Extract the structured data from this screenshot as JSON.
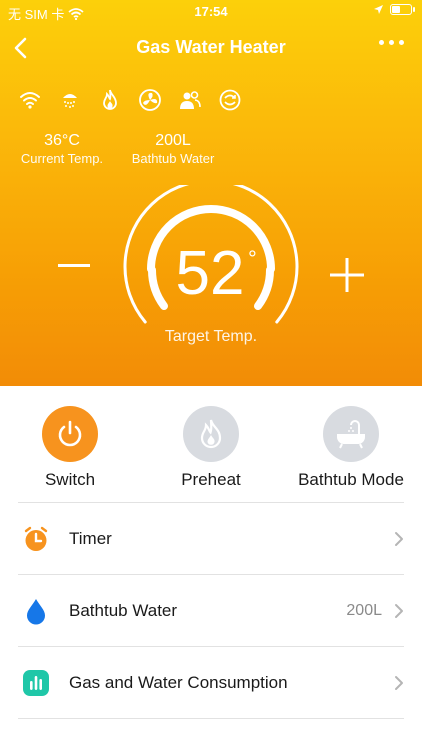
{
  "status_bar": {
    "carrier": "无 SIM 卡",
    "time": "17:54"
  },
  "nav": {
    "title": "Gas Water Heater"
  },
  "readings": [
    {
      "value": "36°C",
      "label": "Current Temp."
    },
    {
      "value": "200L",
      "label": "Bathtub Water"
    }
  ],
  "status_icons": [
    "wifi-icon",
    "shower-icon",
    "flame-icon",
    "fan-icon",
    "people-icon",
    "cycle-icon"
  ],
  "temperature": {
    "value": "52",
    "unit": "°",
    "label": "Target Temp."
  },
  "modes": [
    {
      "label": "Switch",
      "active": true,
      "color": "#f7931e"
    },
    {
      "label": "Preheat",
      "active": false,
      "color": "#d8dbe0"
    },
    {
      "label": "Bathtub Mode",
      "active": false,
      "color": "#d8dbe0"
    }
  ],
  "list": [
    {
      "label": "Timer",
      "value": "",
      "icon": "timer-icon",
      "color": "#f7931e"
    },
    {
      "label": "Bathtub Water",
      "value": "200L",
      "icon": "water-drop-icon",
      "color": "#1677e8"
    },
    {
      "label": "Gas and Water Consumption",
      "value": "",
      "icon": "chart-icon",
      "color": "#1fc7a8"
    }
  ],
  "colors": {
    "accent": "#f7931e",
    "gradient_top": "#fcd00a",
    "gradient_bottom": "#f28c06"
  }
}
